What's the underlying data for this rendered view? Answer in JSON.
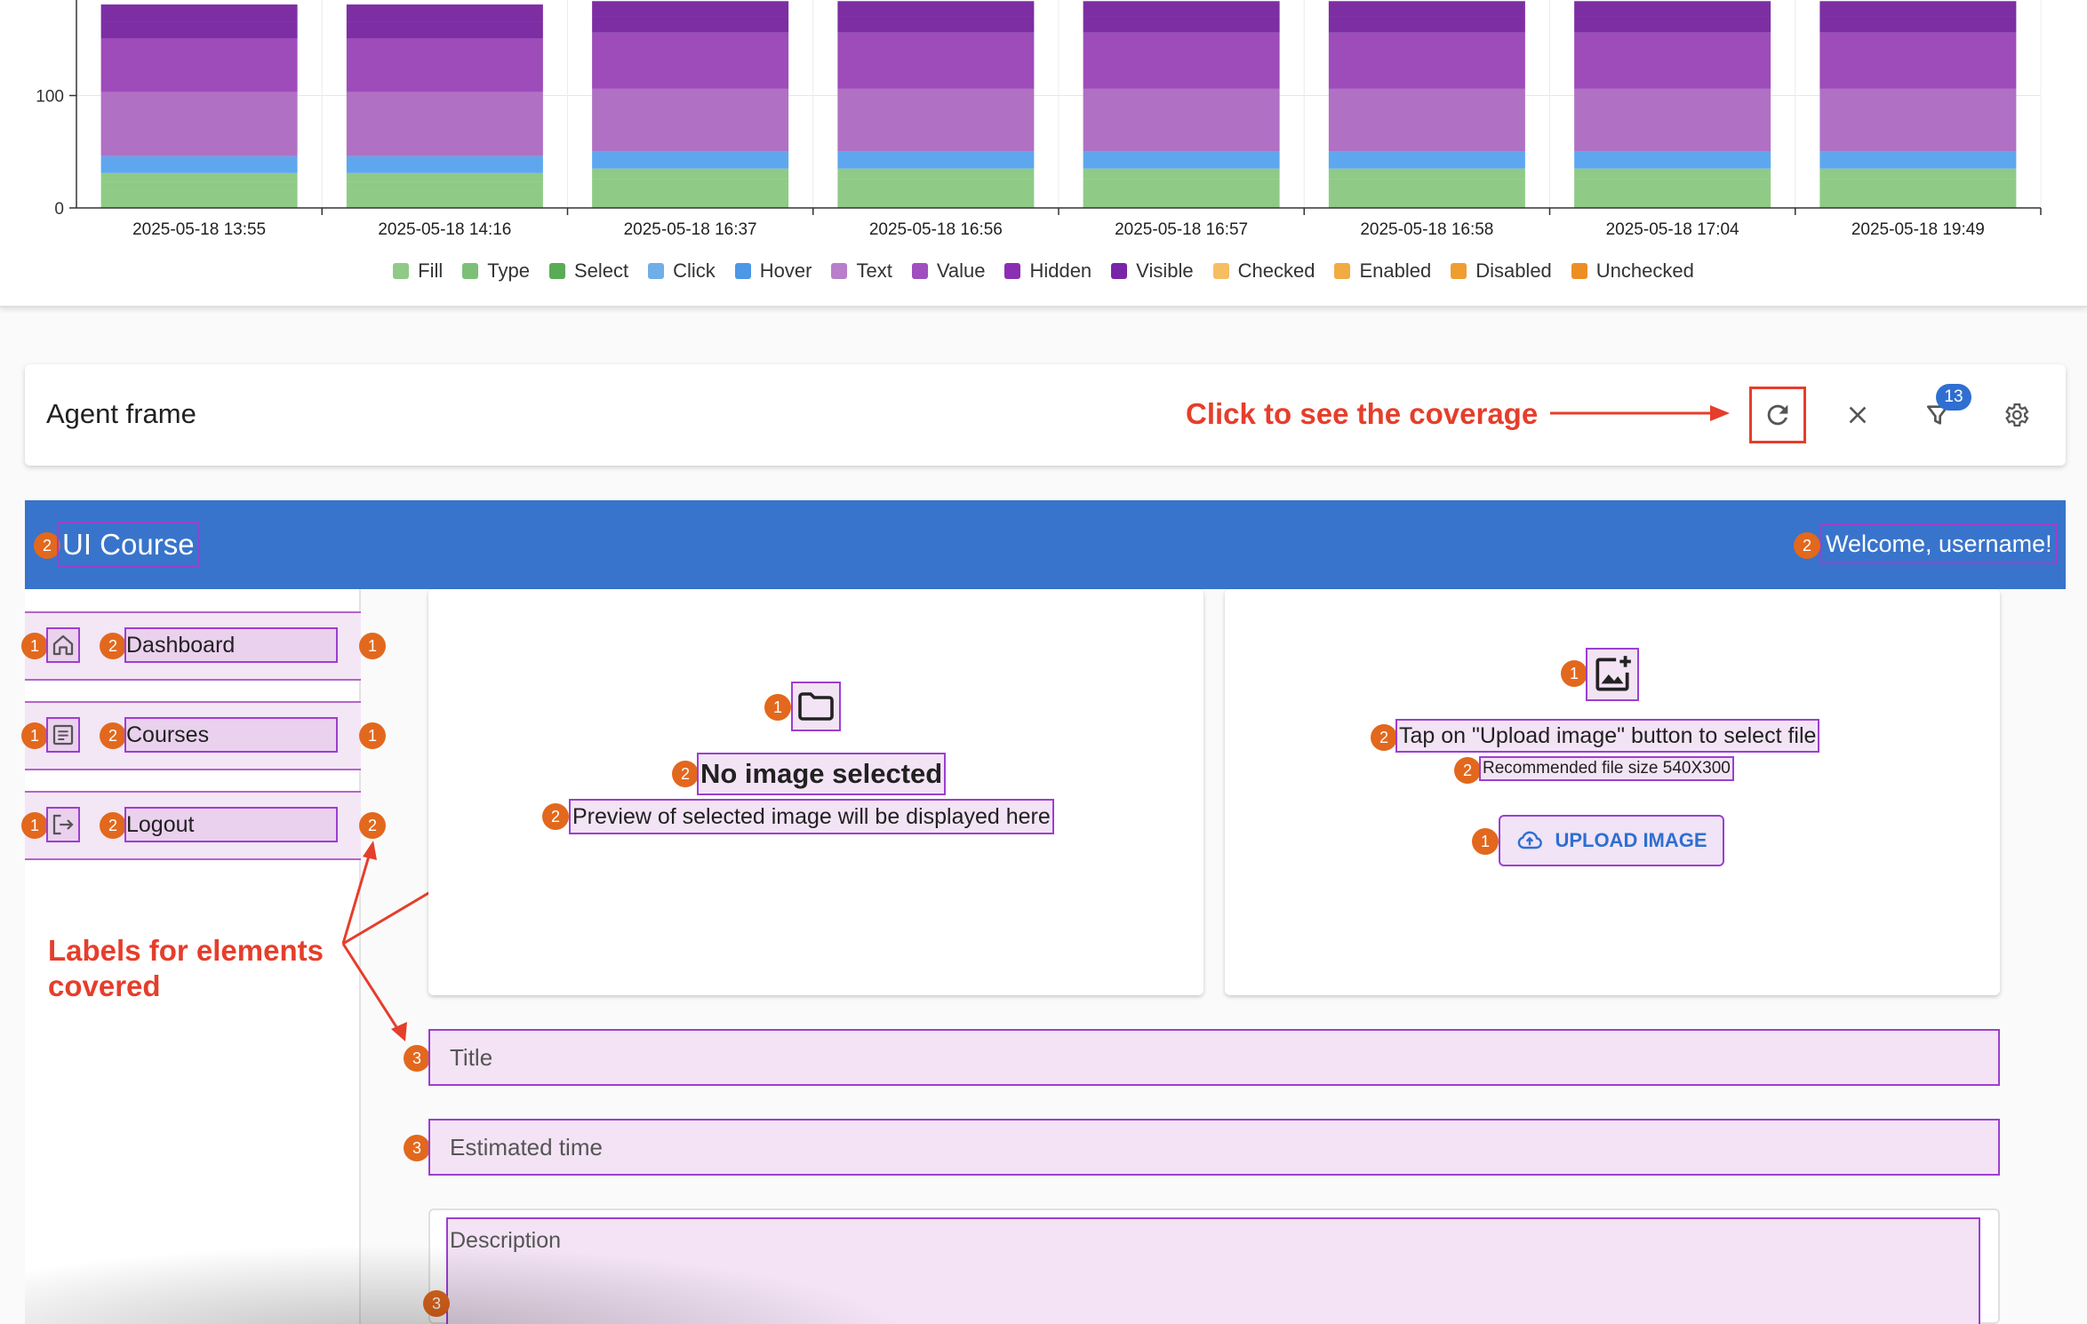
{
  "chart_data": {
    "type": "bar",
    "stacked": true,
    "categories": [
      "2025-05-18 13:55",
      "2025-05-18 14:16",
      "2025-05-18 16:37",
      "2025-05-18 16:56",
      "2025-05-18 16:57",
      "2025-05-18 16:58",
      "2025-05-18 17:04",
      "2025-05-18 19:49"
    ],
    "ytick_labels": [
      "0",
      "100"
    ],
    "series": [
      {
        "name": "Fill",
        "color": "#8fcb86",
        "values": [
          15,
          15,
          17,
          17,
          17,
          17,
          17,
          17
        ]
      },
      {
        "name": "Type",
        "color": "#8fcb86",
        "values": [
          8,
          8,
          9,
          9,
          9,
          9,
          9,
          9
        ]
      },
      {
        "name": "Select",
        "color": "#8fcb86",
        "values": [
          8,
          8,
          9,
          9,
          9,
          9,
          9,
          9
        ]
      },
      {
        "name": "Click",
        "color": "#5ea7ee",
        "values": [
          15,
          15,
          15,
          15,
          15,
          15,
          15,
          15
        ]
      },
      {
        "name": "Hover",
        "color": "#5ea7ee",
        "values": [
          0,
          0,
          0,
          0,
          0,
          0,
          0,
          0
        ]
      },
      {
        "name": "Text",
        "color": "#b070c4",
        "values": [
          57,
          57,
          56,
          56,
          56,
          56,
          56,
          56
        ]
      },
      {
        "name": "Value",
        "color": "#9d4cba",
        "values": [
          48,
          48,
          50,
          50,
          50,
          50,
          50,
          50
        ]
      },
      {
        "name": "Hidden",
        "color": "#7d2ea3",
        "values": [
          15,
          15,
          14,
          14,
          14,
          14,
          14,
          14
        ]
      },
      {
        "name": "Visible",
        "color": "#7d2ea3",
        "values": [
          15,
          15,
          14,
          14,
          14,
          14,
          14,
          14
        ]
      },
      {
        "name": "Checked",
        "color": "#f4b85e",
        "values": [
          0,
          0,
          0,
          0,
          0,
          0,
          0,
          0
        ]
      },
      {
        "name": "Enabled",
        "color": "#f0a73c",
        "values": [
          0,
          0,
          0,
          0,
          0,
          0,
          0,
          0
        ]
      },
      {
        "name": "Disabled",
        "color": "#ef9a2c",
        "values": [
          0,
          0,
          0,
          0,
          0,
          0,
          0,
          0
        ]
      },
      {
        "name": "Unchecked",
        "color": "#ee8f21",
        "values": [
          0,
          0,
          0,
          0,
          0,
          0,
          0,
          0
        ]
      }
    ],
    "legend_colors": [
      "#8fcb86",
      "#7cc077",
      "#5aab55",
      "#6faee9",
      "#4c97e6",
      "#b97fca",
      "#a04fc0",
      "#8a2fb3",
      "#7a24a8",
      "#f6bd63",
      "#f2ab43",
      "#ef9d31",
      "#ed8e24"
    ],
    "ylim": [
      0,
      185
    ],
    "grid": true,
    "legend_position": "bottom"
  },
  "agent_frame": {
    "title": "Agent frame",
    "coverage_hint": "Click to see the coverage",
    "filter_count": "13"
  },
  "annotations": {
    "labels_note_line1": "Labels for elements",
    "labels_note_line2": "covered"
  },
  "app": {
    "title": "UI Course",
    "welcome": "Welcome, username!",
    "sidebar": [
      {
        "label": "Dashboard",
        "icon": "home-icon",
        "left_num": "1",
        "label_num": "2",
        "right_num": "1"
      },
      {
        "label": "Courses",
        "icon": "list-icon",
        "left_num": "1",
        "label_num": "2",
        "right_num": "1"
      },
      {
        "label": "Logout",
        "icon": "logout-icon",
        "left_num": "1",
        "label_num": "2",
        "right_num": "2"
      }
    ],
    "preview_card": {
      "icon_num": "1",
      "heading": "No image selected",
      "heading_num": "2",
      "subtext": "Preview of selected image will be displayed here",
      "subtext_num": "2"
    },
    "upload_card": {
      "icon_num": "1",
      "instruction": "Tap on \"Upload image\" button to select file",
      "instruction_num": "2",
      "recommendation": "Recommended file size 540X300",
      "recommendation_num": "2",
      "button_label": "UPLOAD IMAGE",
      "button_num": "1"
    },
    "title_badge": "2",
    "welcome_badge": "2",
    "fields": [
      {
        "placeholder": "Title",
        "num": "3"
      },
      {
        "placeholder": "Estimated time",
        "num": "3"
      },
      {
        "placeholder": "Description",
        "num": "3"
      }
    ]
  }
}
